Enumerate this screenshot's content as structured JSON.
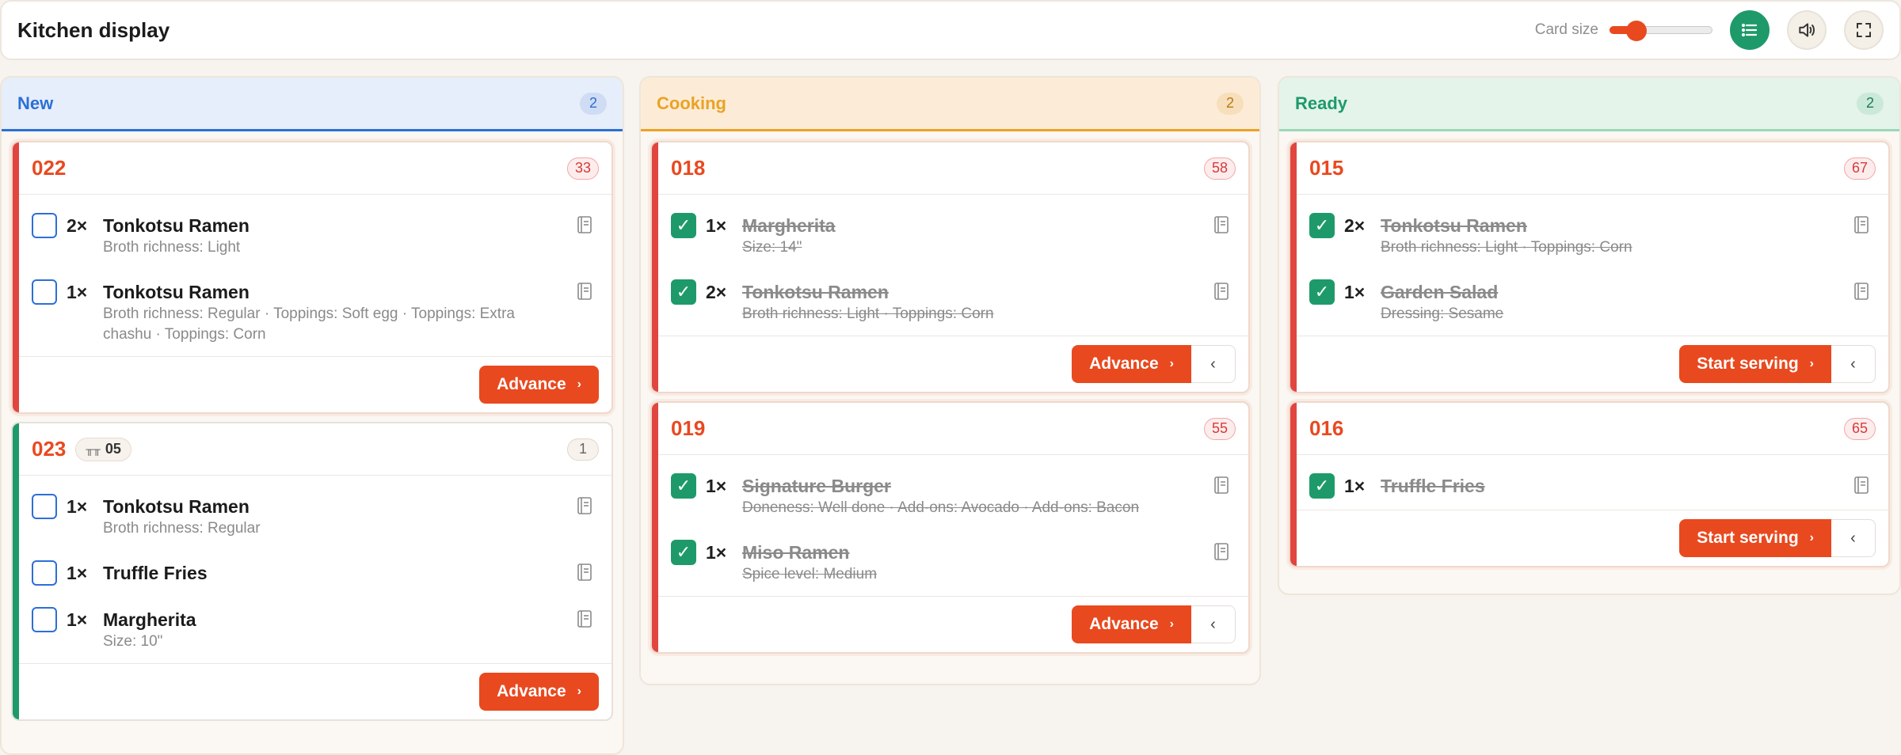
{
  "header": {
    "title": "Kitchen display",
    "card_size_label": "Card size",
    "card_size_value": 0.2
  },
  "colors": {
    "accent": "#e9491f",
    "green": "#1e9a6a",
    "new": "#2c6fd6",
    "cooking": "#eba225"
  },
  "columns": [
    {
      "title": "New",
      "count": "2",
      "tickets": [
        {
          "number": "022",
          "age": "33",
          "items": [
            {
              "qty": "2×",
              "name": "Tonkotsu Ramen",
              "mods": "Broth richness: Light"
            },
            {
              "qty": "1×",
              "name": "Tonkotsu Ramen",
              "mods": "Broth richness: Regular · Toppings: Soft egg · Toppings: Extra chashu · Toppings: Corn"
            }
          ],
          "action": "Advance"
        },
        {
          "number": "023",
          "table": "05",
          "age": "1",
          "items": [
            {
              "qty": "1×",
              "name": "Tonkotsu Ramen",
              "mods": "Broth richness: Regular"
            },
            {
              "qty": "1×",
              "name": "Truffle Fries",
              "mods": ""
            },
            {
              "qty": "1×",
              "name": "Margherita",
              "mods": "Size: 10\""
            }
          ],
          "action": "Advance"
        }
      ]
    },
    {
      "title": "Cooking",
      "count": "2",
      "tickets": [
        {
          "number": "018",
          "age": "58",
          "items": [
            {
              "qty": "1×",
              "name": "Margherita",
              "mods": "Size: 14\""
            },
            {
              "qty": "2×",
              "name": "Tonkotsu Ramen",
              "mods": "Broth richness: Light · Toppings: Corn"
            }
          ],
          "action": "Advance"
        },
        {
          "number": "019",
          "age": "55",
          "items": [
            {
              "qty": "1×",
              "name": "Signature Burger",
              "mods": "Doneness: Well done · Add-ons: Avocado · Add-ons: Bacon"
            },
            {
              "qty": "1×",
              "name": "Miso Ramen",
              "mods": "Spice level: Medium"
            }
          ],
          "action": "Advance"
        }
      ]
    },
    {
      "title": "Ready",
      "count": "2",
      "tickets": [
        {
          "number": "015",
          "age": "67",
          "items": [
            {
              "qty": "2×",
              "name": "Tonkotsu Ramen",
              "mods": "Broth richness: Light · Toppings: Corn"
            },
            {
              "qty": "1×",
              "name": "Garden Salad",
              "mods": "Dressing: Sesame"
            }
          ],
          "action": "Start serving"
        },
        {
          "number": "016",
          "age": "65",
          "items": [
            {
              "qty": "1×",
              "name": "Truffle Fries",
              "mods": ""
            }
          ],
          "action": "Start serving"
        }
      ]
    }
  ]
}
